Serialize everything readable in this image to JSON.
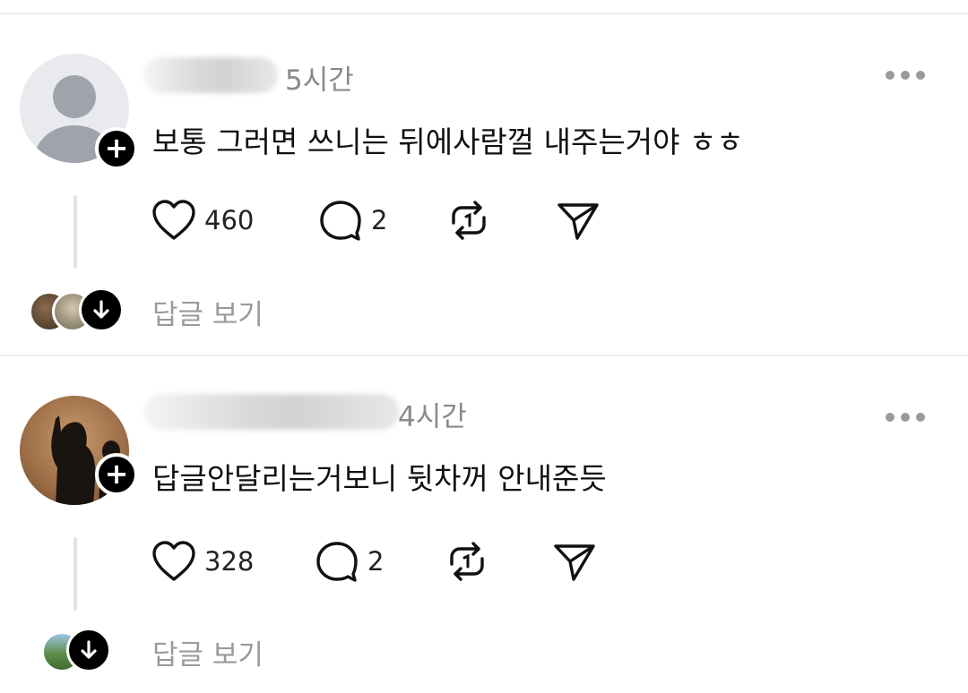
{
  "posts": [
    {
      "time": "5시간",
      "text": "보통 그러면 쓰니는 뒤에사람껄 내주는거야 ㅎㅎ",
      "likes": "460",
      "replies": "2",
      "view_replies": "답글 보기"
    },
    {
      "time": "4시간",
      "text": "답글안달리는거보니 뒷차꺼 안내준듯",
      "likes": "328",
      "replies": "2",
      "view_replies": "답글 보기"
    }
  ],
  "icons": {
    "follow": "+",
    "like": "heart-icon",
    "reply": "comment-icon",
    "repost": "repost-icon",
    "share": "send-icon",
    "more": "more-icon",
    "expand": "arrow-down-icon"
  },
  "colors": {
    "text": "#111111",
    "muted": "#8a8a8a",
    "divider": "#ececec"
  }
}
